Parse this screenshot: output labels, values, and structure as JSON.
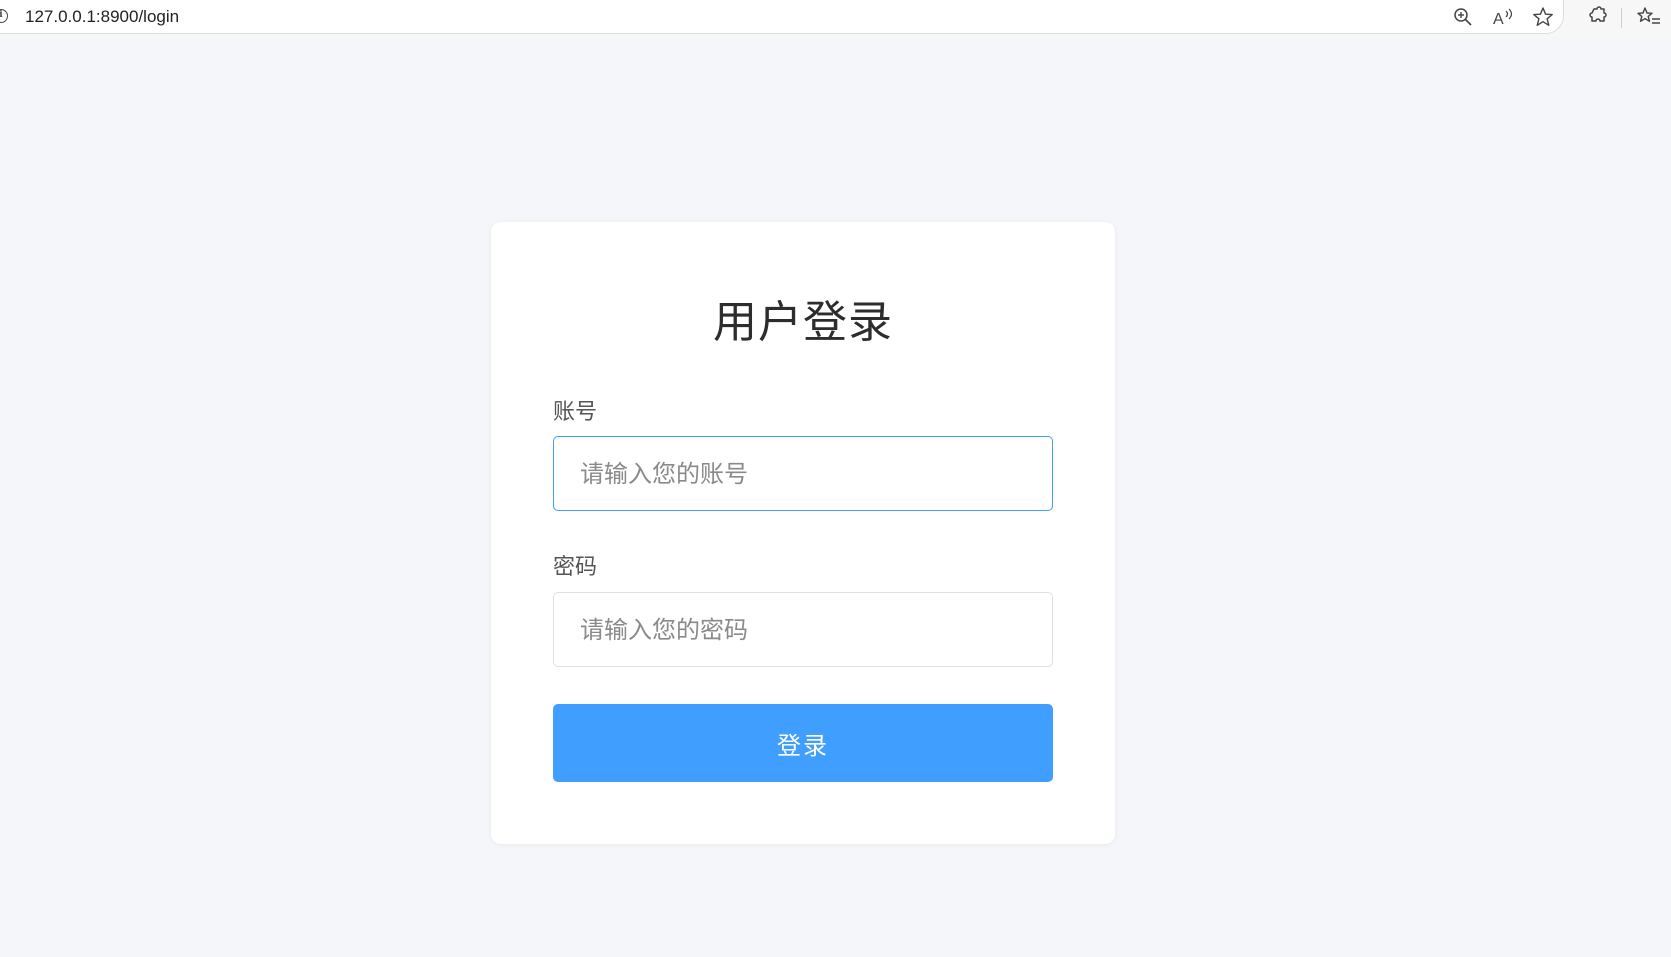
{
  "browser": {
    "url": "127.0.0.1:8900/login",
    "icons": [
      "info-icon",
      "zoom-in-icon",
      "read-aloud-icon",
      "favorite-star-icon",
      "extensions-icon",
      "favorites-list-icon"
    ]
  },
  "login": {
    "title": "用户登录",
    "account": {
      "label": "账号",
      "placeholder": "请输入您的账号",
      "value": ""
    },
    "password": {
      "label": "密码",
      "placeholder": "请输入您的密码",
      "value": ""
    },
    "submit_label": "登录"
  },
  "colors": {
    "page_background": "#f5f6f9",
    "card_background": "#ffffff",
    "primary": "#409eff",
    "input_border": "#dcdfe6",
    "focus_border": "#409eff"
  }
}
